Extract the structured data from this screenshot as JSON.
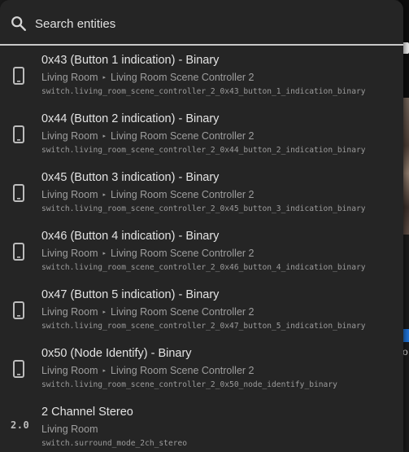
{
  "search": {
    "placeholder": "Search entities",
    "icon": "search-icon"
  },
  "items": [
    {
      "title": "0x43 (Button 1 indication) - Binary",
      "area": "Living Room",
      "separator": "▸",
      "device": "Living Room Scene Controller 2",
      "entity_id": "switch.living_room_scene_controller_2_0x43_button_1_indication_binary",
      "icon": "cellphone-icon"
    },
    {
      "title": "0x44 (Button 2 indication) - Binary",
      "area": "Living Room",
      "separator": "▸",
      "device": "Living Room Scene Controller 2",
      "entity_id": "switch.living_room_scene_controller_2_0x44_button_2_indication_binary",
      "icon": "cellphone-icon"
    },
    {
      "title": "0x45 (Button 3 indication) - Binary",
      "area": "Living Room",
      "separator": "▸",
      "device": "Living Room Scene Controller 2",
      "entity_id": "switch.living_room_scene_controller_2_0x45_button_3_indication_binary",
      "icon": "cellphone-icon"
    },
    {
      "title": "0x46 (Button 4 indication) - Binary",
      "area": "Living Room",
      "separator": "▸",
      "device": "Living Room Scene Controller 2",
      "entity_id": "switch.living_room_scene_controller_2_0x46_button_4_indication_binary",
      "icon": "cellphone-icon"
    },
    {
      "title": "0x47 (Button 5 indication) - Binary",
      "area": "Living Room",
      "separator": "▸",
      "device": "Living Room Scene Controller 2",
      "entity_id": "switch.living_room_scene_controller_2_0x47_button_5_indication_binary",
      "icon": "cellphone-icon"
    },
    {
      "title": "0x50 (Node Identify) - Binary",
      "area": "Living Room",
      "separator": "▸",
      "device": "Living Room Scene Controller 2",
      "entity_id": "switch.living_room_scene_controller_2_0x50_node_identify_binary",
      "icon": "cellphone-icon"
    },
    {
      "title": "2 Channel Stereo",
      "area": "Living Room",
      "entity_id": "switch.surround_mode_2ch_stereo",
      "icon_text": "2.0",
      "icon": "surround-2-0-icon"
    }
  ],
  "background": {
    "partial_letter": "o"
  },
  "colors": {
    "dialog_bg": "#252525",
    "text_primary": "#e3e3e3",
    "text_secondary": "#9e9e9e",
    "divider": "#c9c9c9"
  }
}
